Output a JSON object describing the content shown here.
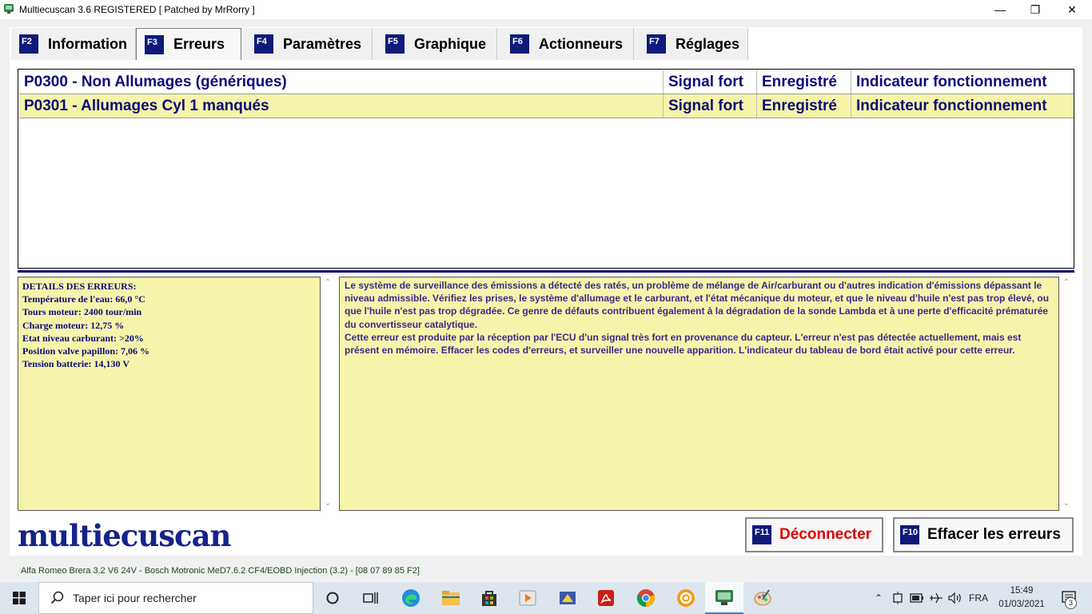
{
  "window": {
    "title": "Multiecuscan 3.6 REGISTERED    [ Patched by MrRorry ]",
    "minimize_glyph": "—",
    "maximize_glyph": "❐",
    "close_glyph": "✕"
  },
  "tabs": [
    {
      "key": "F2",
      "label": "Information",
      "active": false
    },
    {
      "key": "F3",
      "label": "Erreurs",
      "active": true
    },
    {
      "key": "F4",
      "label": "Paramètres",
      "active": false
    },
    {
      "key": "F5",
      "label": "Graphique",
      "active": false
    },
    {
      "key": "F6",
      "label": "Actionneurs",
      "active": false
    },
    {
      "key": "F7",
      "label": "Réglages",
      "active": false
    }
  ],
  "errors": [
    {
      "code": "P0300 - Non Allumages (génériques)",
      "signal": "Signal fort",
      "state": "Enregistré",
      "indicator": "Indicateur fonctionnement"
    },
    {
      "code": "P0301 - Allumages Cyl 1 manqués",
      "signal": "Signal fort",
      "state": "Enregistré",
      "indicator": "Indicateur fonctionnement"
    }
  ],
  "details": {
    "heading": "DETAILS DES ERREURS:",
    "lines": [
      "Température de l'eau: 66,0 °C",
      "Tours moteur: 2400 tour/min",
      "Charge moteur: 12,75 %",
      "Etat niveau carburant: >20%",
      "Position valve papillon: 7,06 %",
      "Tension batterie: 14,130 V"
    ]
  },
  "description": {
    "p1": "Le système de surveillance des émissions a détecté des ratés, un problème de mélange de Air/carburant ou d'autres indication d'émissions dépassant le niveau admissible. Vérifiez les prises, le système d'allumage et le carburant, et l'état mécanique du moteur, et que le niveau d'huile n'est pas trop élevé, ou que l'huile n'est pas trop dégradée. Ce genre de défauts contribuent également à la dégradation de la sonde Lambda et à une perte d'efficacité prématurée du convertisseur catalytique.",
    "p2": "Cette erreur est produite par la réception par l'ECU d'un signal très fort en provenance du capteur. L'erreur n'est pas détectée actuellement, mais est présent en mémoire. Effacer les codes d'erreurs, et surveiller une nouvelle apparition. L'indicateur du tableau de bord était activé pour cette erreur."
  },
  "logo": "multiecuscan",
  "buttons": {
    "disconnect": {
      "key": "F11",
      "label": "Déconnecter"
    },
    "clear": {
      "key": "F10",
      "label": "Effacer les erreurs"
    }
  },
  "status": {
    "vehicle": "Alfa Romeo Brera 3.2 V6 24V - Bosch Motronic MeD7.6.2 CF4/EOBD Injection (3.2) - [08 07 89 85 F2]"
  },
  "taskbar": {
    "search_placeholder": "Taper ici pour rechercher",
    "language": "FRA",
    "time": "15:49",
    "date": "01/03/2021",
    "notification_count": "3"
  },
  "colors": {
    "tab_key_bg": "#0d1a7a",
    "error_text": "#0b0b7a",
    "highlight_row": "#f6f4aa",
    "disconnect_text": "#e00000"
  }
}
